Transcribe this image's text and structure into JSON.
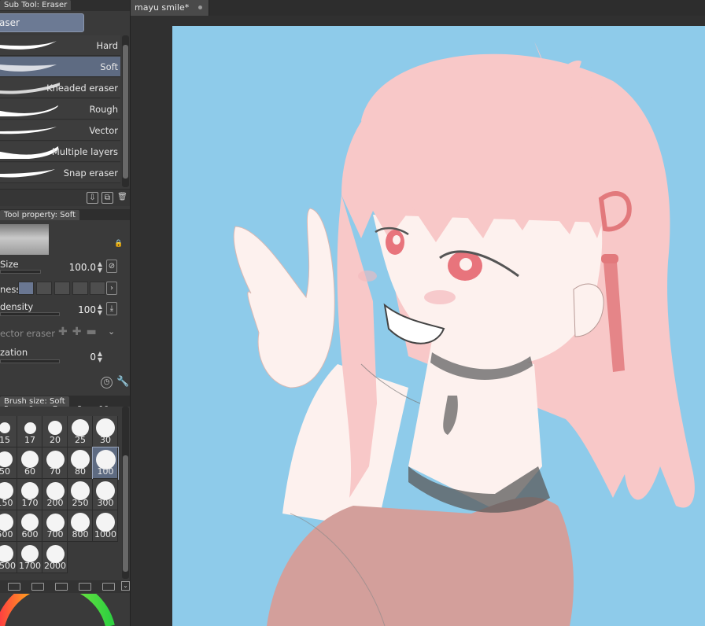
{
  "subtool_panel": {
    "tab_label": "Sub Tool: Eraser",
    "group_button": "aser",
    "erasers": [
      {
        "label": "Hard",
        "selected": false
      },
      {
        "label": "Soft",
        "selected": true
      },
      {
        "label": "Kneaded eraser",
        "selected": false
      },
      {
        "label": "Rough",
        "selected": false
      },
      {
        "label": "Vector",
        "selected": false
      },
      {
        "label": "Multiple layers",
        "selected": false
      },
      {
        "label": "Snap eraser",
        "selected": false
      }
    ],
    "footer_icons": [
      "download-icon",
      "copy-icon",
      "trash-icon"
    ]
  },
  "tool_property": {
    "tab_label": "Tool property: Soft",
    "brush_size_label": "Size",
    "brush_size_value": "100.0",
    "hardness_label": "ness",
    "brush_density_label": "density",
    "brush_density_value": "100",
    "vector_eraser_label": "ector eraser",
    "stabilization_label": "zation",
    "stabilization_value": "0"
  },
  "brush_size_panel": {
    "tab_label": "Brush size: Soft",
    "header_numbers": [
      "5",
      "6",
      "7",
      "8",
      "10"
    ],
    "rows": [
      [
        {
          "v": "15",
          "d": 14
        },
        {
          "v": "17",
          "d": 15
        },
        {
          "v": "20",
          "d": 18
        },
        {
          "v": "25",
          "d": 22
        },
        {
          "v": "30",
          "d": 24
        }
      ],
      [
        {
          "v": "50",
          "d": 20
        },
        {
          "v": "60",
          "d": 22
        },
        {
          "v": "70",
          "d": 23
        },
        {
          "v": "80",
          "d": 24
        },
        {
          "v": "100",
          "d": 25
        }
      ],
      [
        {
          "v": "150",
          "d": 22
        },
        {
          "v": "170",
          "d": 22
        },
        {
          "v": "200",
          "d": 23
        },
        {
          "v": "250",
          "d": 24
        },
        {
          "v": "300",
          "d": 24
        }
      ],
      [
        {
          "v": "500",
          "d": 22
        },
        {
          "v": "600",
          "d": 22
        },
        {
          "v": "700",
          "d": 23
        },
        {
          "v": "800",
          "d": 24
        },
        {
          "v": "1000",
          "d": 24
        }
      ],
      [
        {
          "v": "1500",
          "d": 22
        },
        {
          "v": "1700",
          "d": 22
        },
        {
          "v": "2000",
          "d": 23
        }
      ]
    ],
    "selected_value": "100"
  },
  "document": {
    "tab_title": "mayu smile*"
  },
  "colors": {
    "canvas_bg": "#8ecbea",
    "hair": "#f8c8c8",
    "skin": "#fdf1ee",
    "shirt": "#d39f9b",
    "ribbon": "#e2797c",
    "eye": "#e8747c"
  }
}
